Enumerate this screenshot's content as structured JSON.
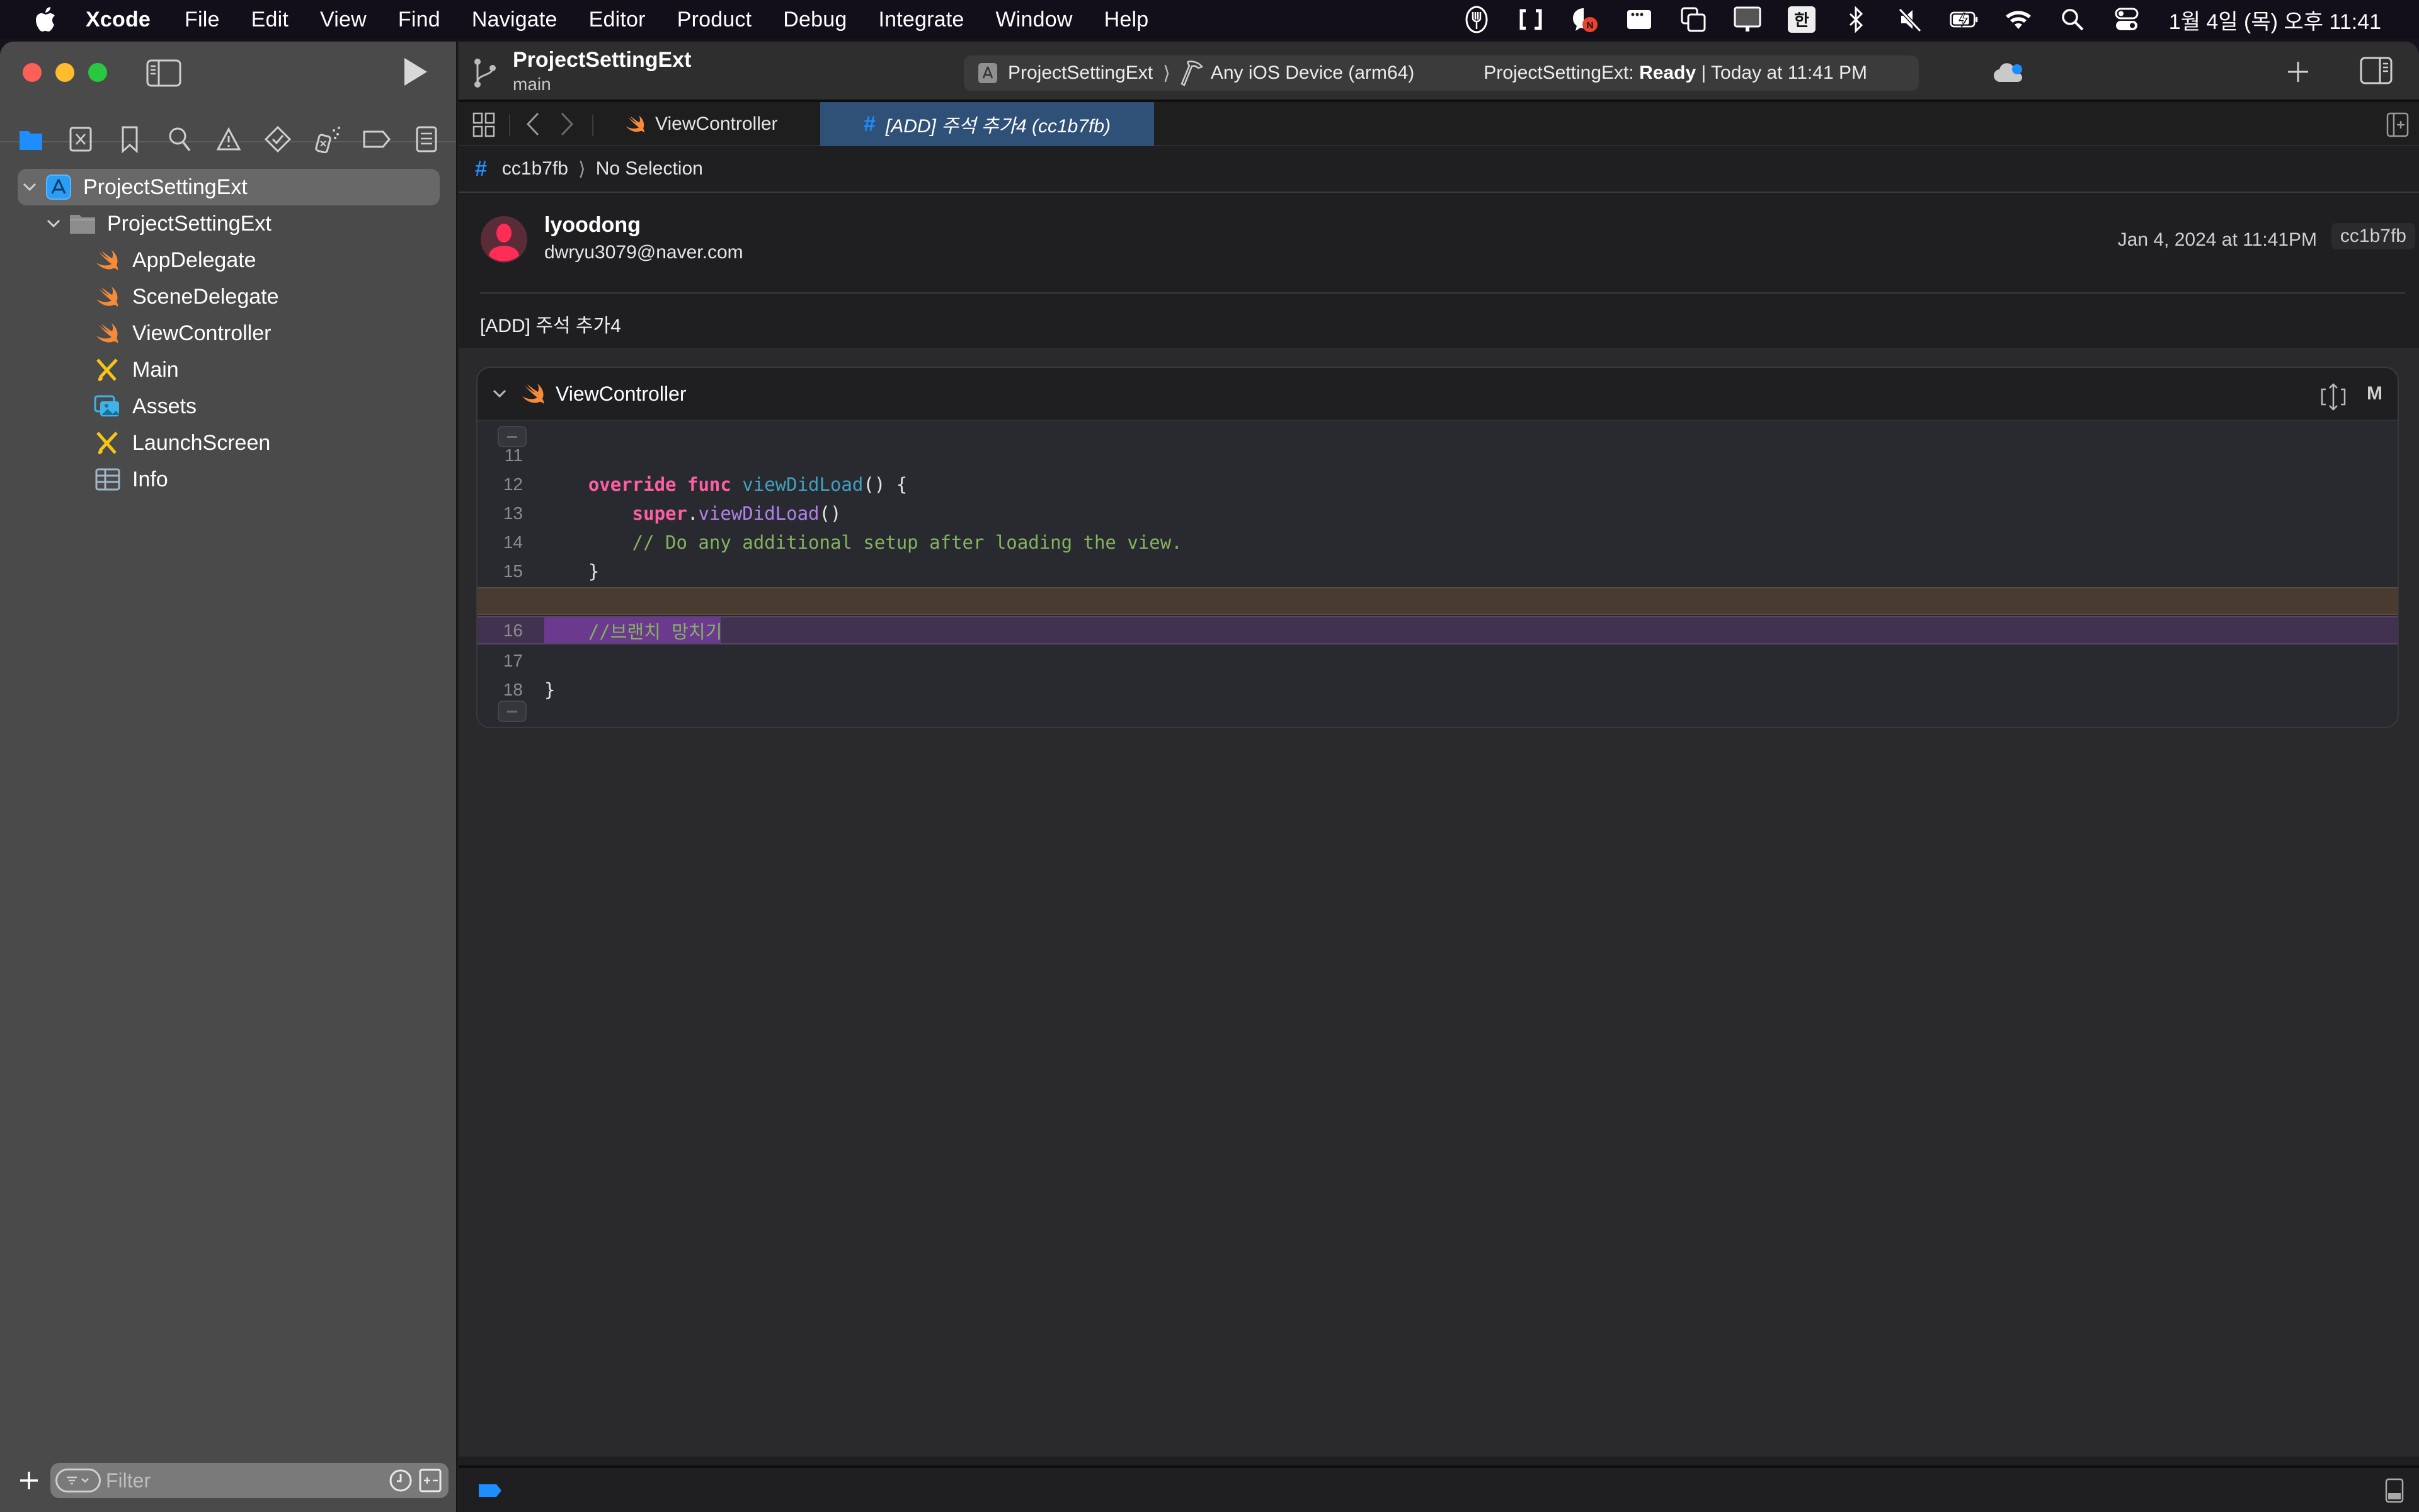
{
  "menubar": {
    "app_name": "Xcode",
    "items": [
      "File",
      "Edit",
      "View",
      "Find",
      "Navigate",
      "Editor",
      "Product",
      "Debug",
      "Integrate",
      "Window",
      "Help"
    ],
    "status_icons": [
      "fork-icon",
      "bracket-app-icon",
      "naver-talk-icon",
      "window-dots-icon",
      "stage-manager-icon",
      "display-icon",
      "input-hangul-icon",
      "bluetooth-icon",
      "mute-icon",
      "battery-charging-icon",
      "wifi-icon",
      "spotlight-icon",
      "control-center-icon"
    ],
    "input_source": "한",
    "clock": "1월 4일 (목) 오후 11:41"
  },
  "toolbar": {
    "project_title": "ProjectSettingExt",
    "branch": "main",
    "scheme": "ProjectSettingExt",
    "destination": "Any iOS Device (arm64)",
    "status_prefix": "ProjectSettingExt: ",
    "status_state": "Ready",
    "status_suffix": " | Today at 11:41 PM"
  },
  "navigator": {
    "tree": [
      {
        "label": "ProjectSettingExt",
        "type": "project",
        "level": 0,
        "expanded": true,
        "selected": true
      },
      {
        "label": "ProjectSettingExt",
        "type": "folder",
        "level": 1,
        "expanded": true
      },
      {
        "label": "AppDelegate",
        "type": "swift",
        "level": 2
      },
      {
        "label": "SceneDelegate",
        "type": "swift",
        "level": 2
      },
      {
        "label": "ViewController",
        "type": "swift",
        "level": 2
      },
      {
        "label": "Main",
        "type": "storyboard",
        "level": 2
      },
      {
        "label": "Assets",
        "type": "assets",
        "level": 2
      },
      {
        "label": "LaunchScreen",
        "type": "storyboard",
        "level": 2
      },
      {
        "label": "Info",
        "type": "plist",
        "level": 2
      }
    ],
    "filter_placeholder": "Filter"
  },
  "tabs": [
    {
      "label": "ViewController",
      "icon": "swift-icon",
      "active": false
    },
    {
      "label": "[ADD] 주석 추가4 (cc1b7fb)",
      "icon": "commit-hash-icon",
      "active": true
    }
  ],
  "jumpbar": {
    "commit": "cc1b7fb",
    "selection": "No Selection"
  },
  "commit": {
    "author": "lyoodong",
    "email": "dwryu3079@naver.com",
    "date": "Jan 4, 2024 at 11:41PM",
    "hash": "cc1b7fb",
    "message": "[ADD] 주석 추가4"
  },
  "diff": {
    "file": "ViewController",
    "status": "M",
    "lines": [
      {
        "n": "11",
        "tokens": []
      },
      {
        "n": "12",
        "tokens": [
          [
            "kw",
            "    override"
          ],
          [
            "plain",
            " "
          ],
          [
            "kw",
            "func"
          ],
          [
            "plain",
            " "
          ],
          [
            "fn",
            "viewDidLoad"
          ],
          [
            "plain",
            "() {"
          ]
        ]
      },
      {
        "n": "13",
        "tokens": [
          [
            "kw",
            "        super"
          ],
          [
            "plain",
            "."
          ],
          [
            "call",
            "viewDidLoad"
          ],
          [
            "plain",
            "()"
          ]
        ]
      },
      {
        "n": "14",
        "tokens": [
          [
            "cmt",
            "        // Do any additional setup after loading the view."
          ]
        ]
      },
      {
        "n": "15",
        "tokens": [
          [
            "plain",
            "    }"
          ]
        ]
      },
      {
        "n": "16",
        "tokens": [
          [
            "cmt",
            "    //브랜치 망치기"
          ]
        ],
        "change": "added"
      },
      {
        "n": "17",
        "tokens": []
      },
      {
        "n": "18",
        "tokens": [
          [
            "plain",
            "}"
          ]
        ]
      }
    ]
  },
  "colors": {
    "accent": "#1e8dff",
    "active_tab": "#2f5077",
    "added_line": "#41324f",
    "removed_band": "#4a3b30",
    "keyword": "#fc5fa3",
    "function": "#41a1c0",
    "comment": "#84b360",
    "swift_orange": "#f48a3a"
  }
}
